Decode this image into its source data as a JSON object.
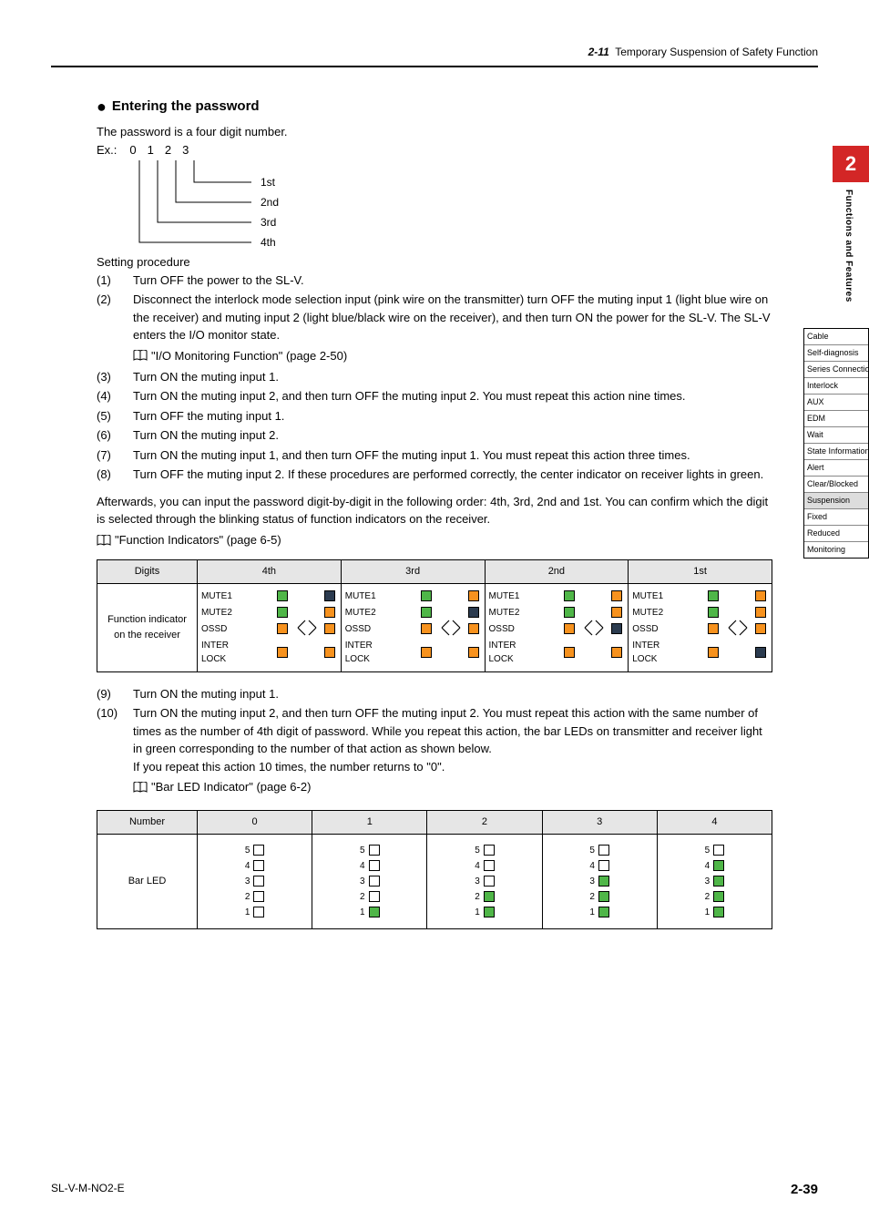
{
  "header": {
    "section_num": "2-11",
    "section_title": "Temporary Suspension of Safety Function"
  },
  "chapter_tab": {
    "number": "2",
    "label": "Functions and Features"
  },
  "side_nav": [
    {
      "label": "Cable",
      "active": false
    },
    {
      "label": "Self-diagnosis",
      "active": false
    },
    {
      "label": "Series Connection",
      "active": false
    },
    {
      "label": "Interlock",
      "active": false
    },
    {
      "label": "AUX",
      "active": false
    },
    {
      "label": "EDM",
      "active": false
    },
    {
      "label": "Wait",
      "active": false
    },
    {
      "label": "State Information",
      "active": false
    },
    {
      "label": "Alert",
      "active": false
    },
    {
      "label": "Clear/Blocked",
      "active": false
    },
    {
      "label": "Suspension",
      "active": true
    },
    {
      "label": "Fixed",
      "active": false
    },
    {
      "label": "Reduced",
      "active": false
    },
    {
      "label": "Monitoring",
      "active": false
    }
  ],
  "content": {
    "h_sub": "Entering the password",
    "p_intro": "The password is a four digit number.",
    "ex_label": "Ex.:",
    "ex_digits": [
      "0",
      "1",
      "2",
      "3"
    ],
    "ex_order": [
      "1st",
      "2nd",
      "3rd",
      "4th"
    ],
    "setting_heading": "Setting procedure",
    "steps_a": [
      {
        "n": "(1)",
        "t": "Turn OFF the power to the SL-V."
      },
      {
        "n": "(2)",
        "t": "Disconnect the interlock mode selection input (pink wire on the transmitter) turn OFF the muting input 1 (light blue wire on the receiver) and muting input 2 (light blue/black wire on the receiver), and then turn ON the power for the SL-V. The SL-V enters the I/O monitor state.",
        "ref": "\"I/O Monitoring Function\" (page 2-50)"
      },
      {
        "n": "(3)",
        "t": "Turn ON the muting input 1."
      },
      {
        "n": "(4)",
        "t": "Turn ON the muting input 2, and then turn OFF the muting input 2. You must repeat this action nine times."
      },
      {
        "n": "(5)",
        "t": "Turn OFF the muting input 1."
      },
      {
        "n": "(6)",
        "t": "Turn ON the muting input 2."
      },
      {
        "n": "(7)",
        "t": "Turn ON the muting input 1, and then turn OFF the muting input 1. You must repeat this action three times."
      },
      {
        "n": "(8)",
        "t": "Turn OFF the muting input 2. If these procedures are performed correctly, the center indicator on receiver lights in green."
      }
    ],
    "para_after": "Afterwards, you can input the password digit-by-digit in the following order: 4th, 3rd, 2nd and 1st. You can confirm which the digit is selected through the blinking status of function indicators on the receiver.",
    "ref_func": "\"Function Indicators\" (page 6-5)",
    "table1": {
      "head": [
        "Digits",
        "4th",
        "3rd",
        "2nd",
        "1st"
      ],
      "rowhead": "Function indicator on the receiver",
      "labels": [
        "MUTE1",
        "MUTE2",
        "OSSD",
        "INTER\nLOCK"
      ],
      "cols": [
        {
          "left": [
            "g",
            "g",
            "o",
            "o"
          ],
          "right": [
            "b",
            "o",
            "o",
            "o"
          ]
        },
        {
          "left": [
            "g",
            "g",
            "o",
            "o"
          ],
          "right": [
            "o",
            "b",
            "o",
            "o"
          ]
        },
        {
          "left": [
            "g",
            "g",
            "o",
            "o"
          ],
          "right": [
            "o",
            "o",
            "b",
            "o"
          ]
        },
        {
          "left": [
            "g",
            "g",
            "o",
            "o"
          ],
          "right": [
            "o",
            "o",
            "o",
            "b"
          ]
        }
      ]
    },
    "steps_b": [
      {
        "n": "(9)",
        "t": "Turn ON the muting input 1."
      },
      {
        "n": "(10)",
        "t": "Turn ON the muting input 2, and then turn OFF the muting input 2. You must repeat this action with the same number of times as the number of 4th digit of password. While you repeat this action, the bar LEDs on transmitter and receiver light in green corresponding to the number of that action as shown below.",
        "extra": "If you repeat this action 10 times, the number returns to \"0\".",
        "ref": "\"Bar LED Indicator\" (page 6-2)"
      }
    ],
    "table2": {
      "head": [
        "Number",
        "0",
        "1",
        "2",
        "3",
        "4"
      ],
      "rowhead": "Bar LED",
      "rows": [
        "5",
        "4",
        "3",
        "2",
        "1"
      ],
      "cols": [
        [
          false,
          false,
          false,
          false,
          false
        ],
        [
          false,
          false,
          false,
          false,
          true
        ],
        [
          false,
          false,
          false,
          true,
          true
        ],
        [
          false,
          false,
          true,
          true,
          true
        ],
        [
          false,
          true,
          true,
          true,
          true
        ]
      ]
    }
  },
  "footer": {
    "doc": "SL-V-M-NO2-E",
    "page": "2-39"
  }
}
